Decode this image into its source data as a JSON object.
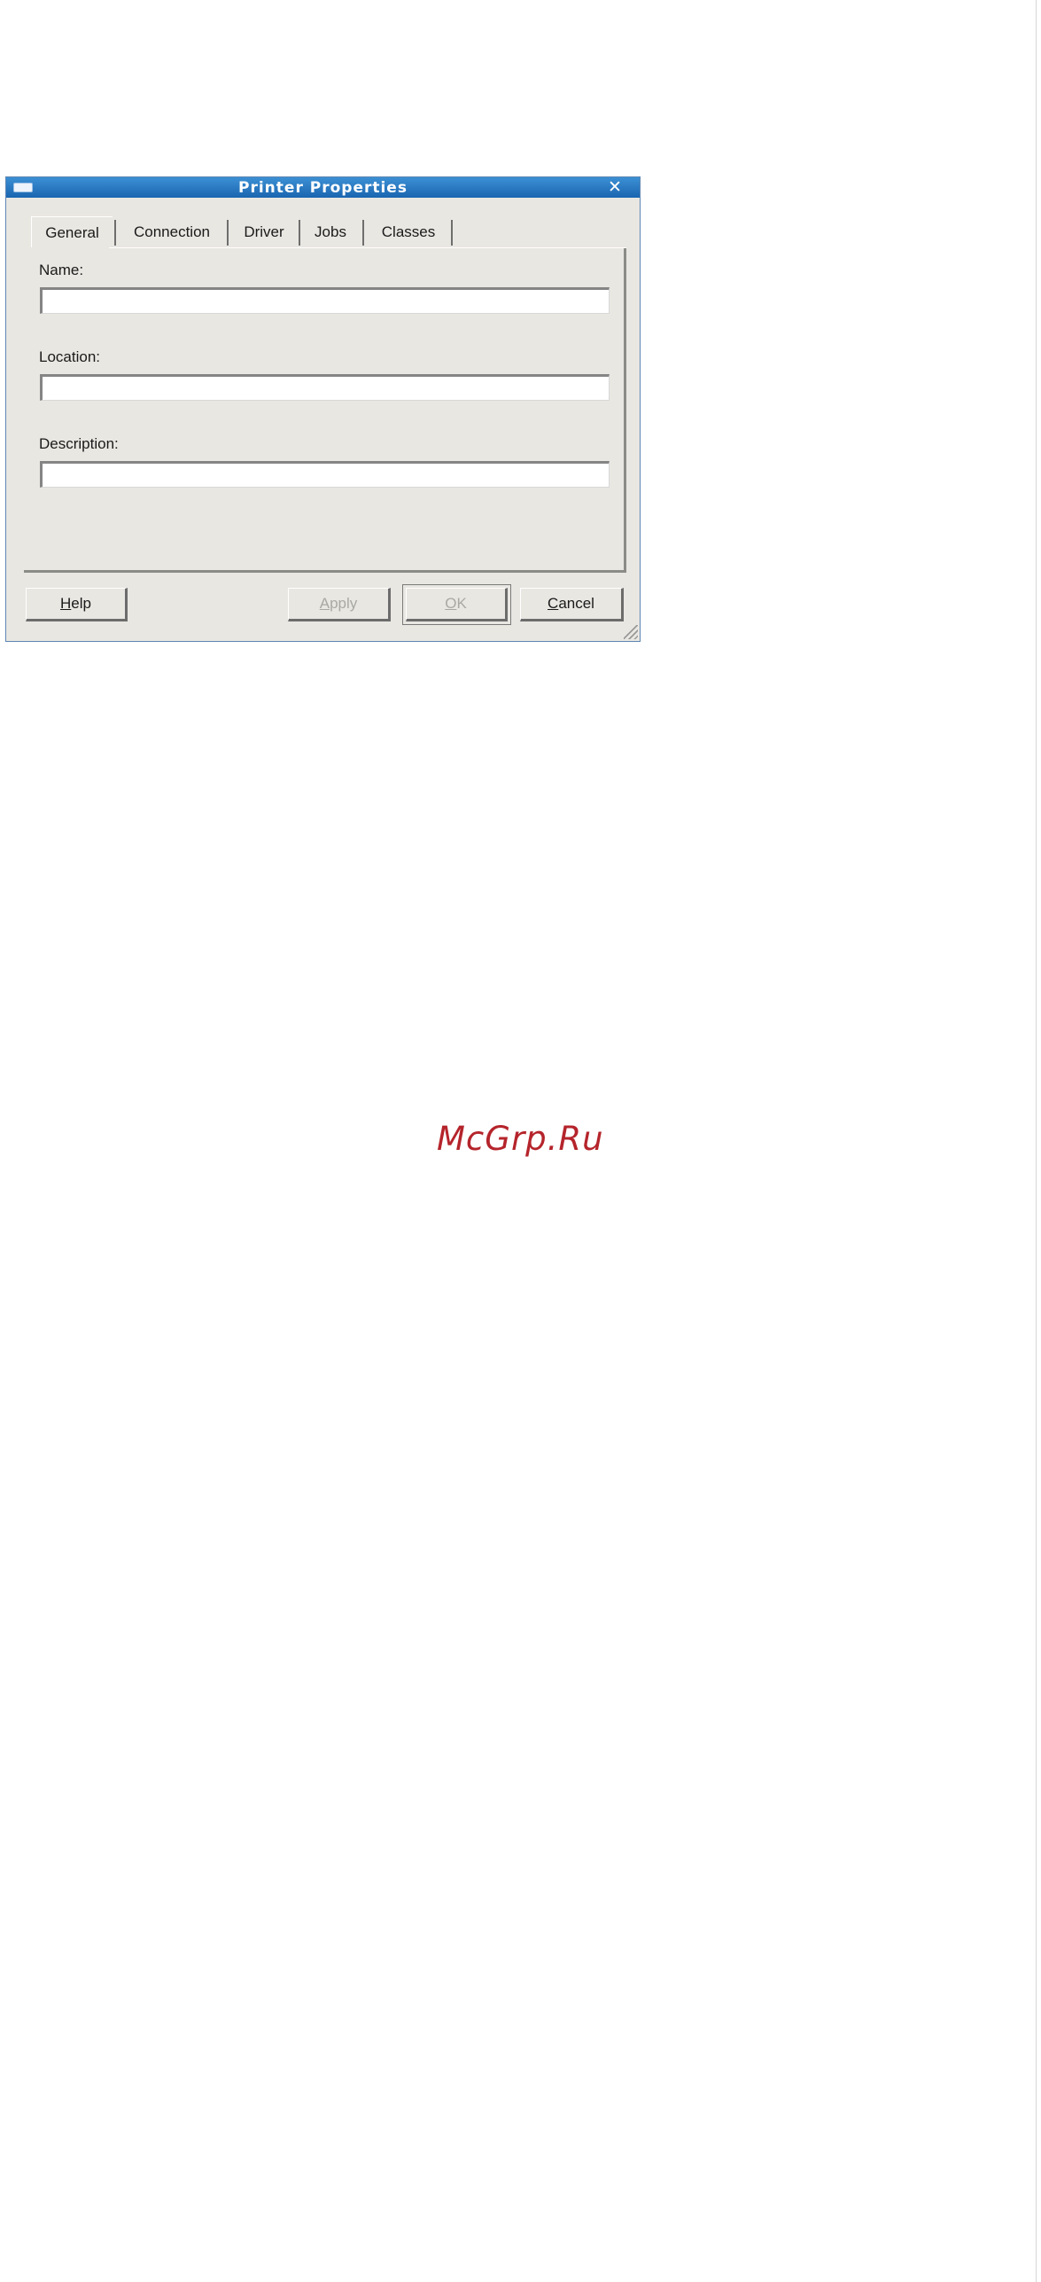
{
  "window": {
    "title": "Printer Properties"
  },
  "tabs": [
    {
      "label": "General",
      "active": true
    },
    {
      "label": "Connection",
      "active": false
    },
    {
      "label": "Driver",
      "active": false
    },
    {
      "label": "Jobs",
      "active": false
    },
    {
      "label": "Classes",
      "active": false
    }
  ],
  "fields": {
    "name": {
      "label": "Name:",
      "value": ""
    },
    "location": {
      "label": "Location:",
      "value": ""
    },
    "description": {
      "label": "Description:",
      "value": ""
    }
  },
  "buttons": {
    "help": {
      "mnemonic": "H",
      "rest": "elp",
      "enabled": true
    },
    "apply": {
      "mnemonic": "A",
      "rest": "pply",
      "enabled": false
    },
    "ok": {
      "mnemonic": "O",
      "rest": "K",
      "enabled": false
    },
    "cancel": {
      "mnemonic": "C",
      "rest": "ancel",
      "enabled": true
    }
  },
  "watermark": {
    "text": "McGrp.Ru"
  },
  "colors": {
    "titlebar": "#1f6fbf",
    "dialog_background": "#e9e7e2",
    "watermark": "#b5242b"
  }
}
